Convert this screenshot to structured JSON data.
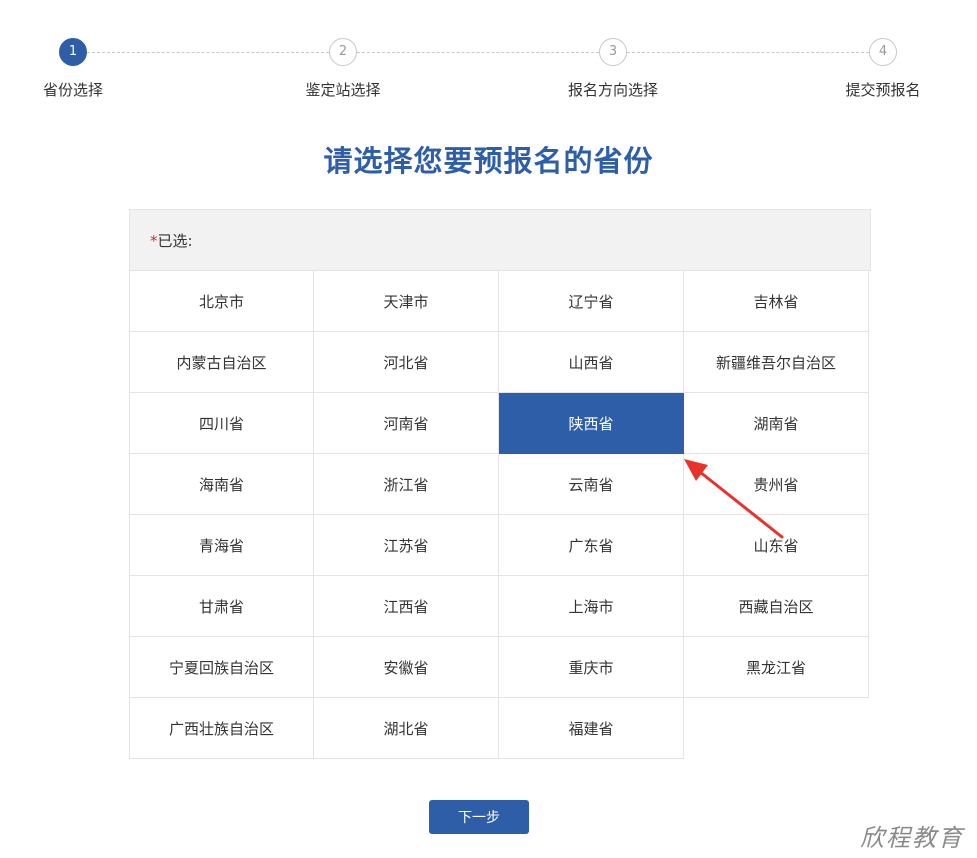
{
  "steps": [
    {
      "number": "1",
      "label": "省份选择",
      "active": true
    },
    {
      "number": "2",
      "label": "鉴定站选择",
      "active": false
    },
    {
      "number": "3",
      "label": "报名方向选择",
      "active": false
    },
    {
      "number": "4",
      "label": "提交预报名",
      "active": false
    }
  ],
  "title": "请选择您要预报名的省份",
  "selected_label_prefix": "*",
  "selected_label": "已选:",
  "selected_value": "",
  "provinces": [
    "北京市",
    "天津市",
    "辽宁省",
    "吉林省",
    "内蒙古自治区",
    "河北省",
    "山西省",
    "新疆维吾尔自治区",
    "四川省",
    "河南省",
    "陕西省",
    "湖南省",
    "海南省",
    "浙江省",
    "云南省",
    "贵州省",
    "青海省",
    "江苏省",
    "广东省",
    "山东省",
    "甘肃省",
    "江西省",
    "上海市",
    "西藏自治区",
    "宁夏回族自治区",
    "安徽省",
    "重庆市",
    "黑龙江省",
    "广西壮族自治区",
    "湖北省",
    "福建省"
  ],
  "highlighted_province": "陕西省",
  "next_button": "下一步",
  "watermark": "欣程教育",
  "colors": {
    "accent": "#2f5ea9",
    "required": "#e02a2a",
    "arrow": "#e8322a"
  }
}
